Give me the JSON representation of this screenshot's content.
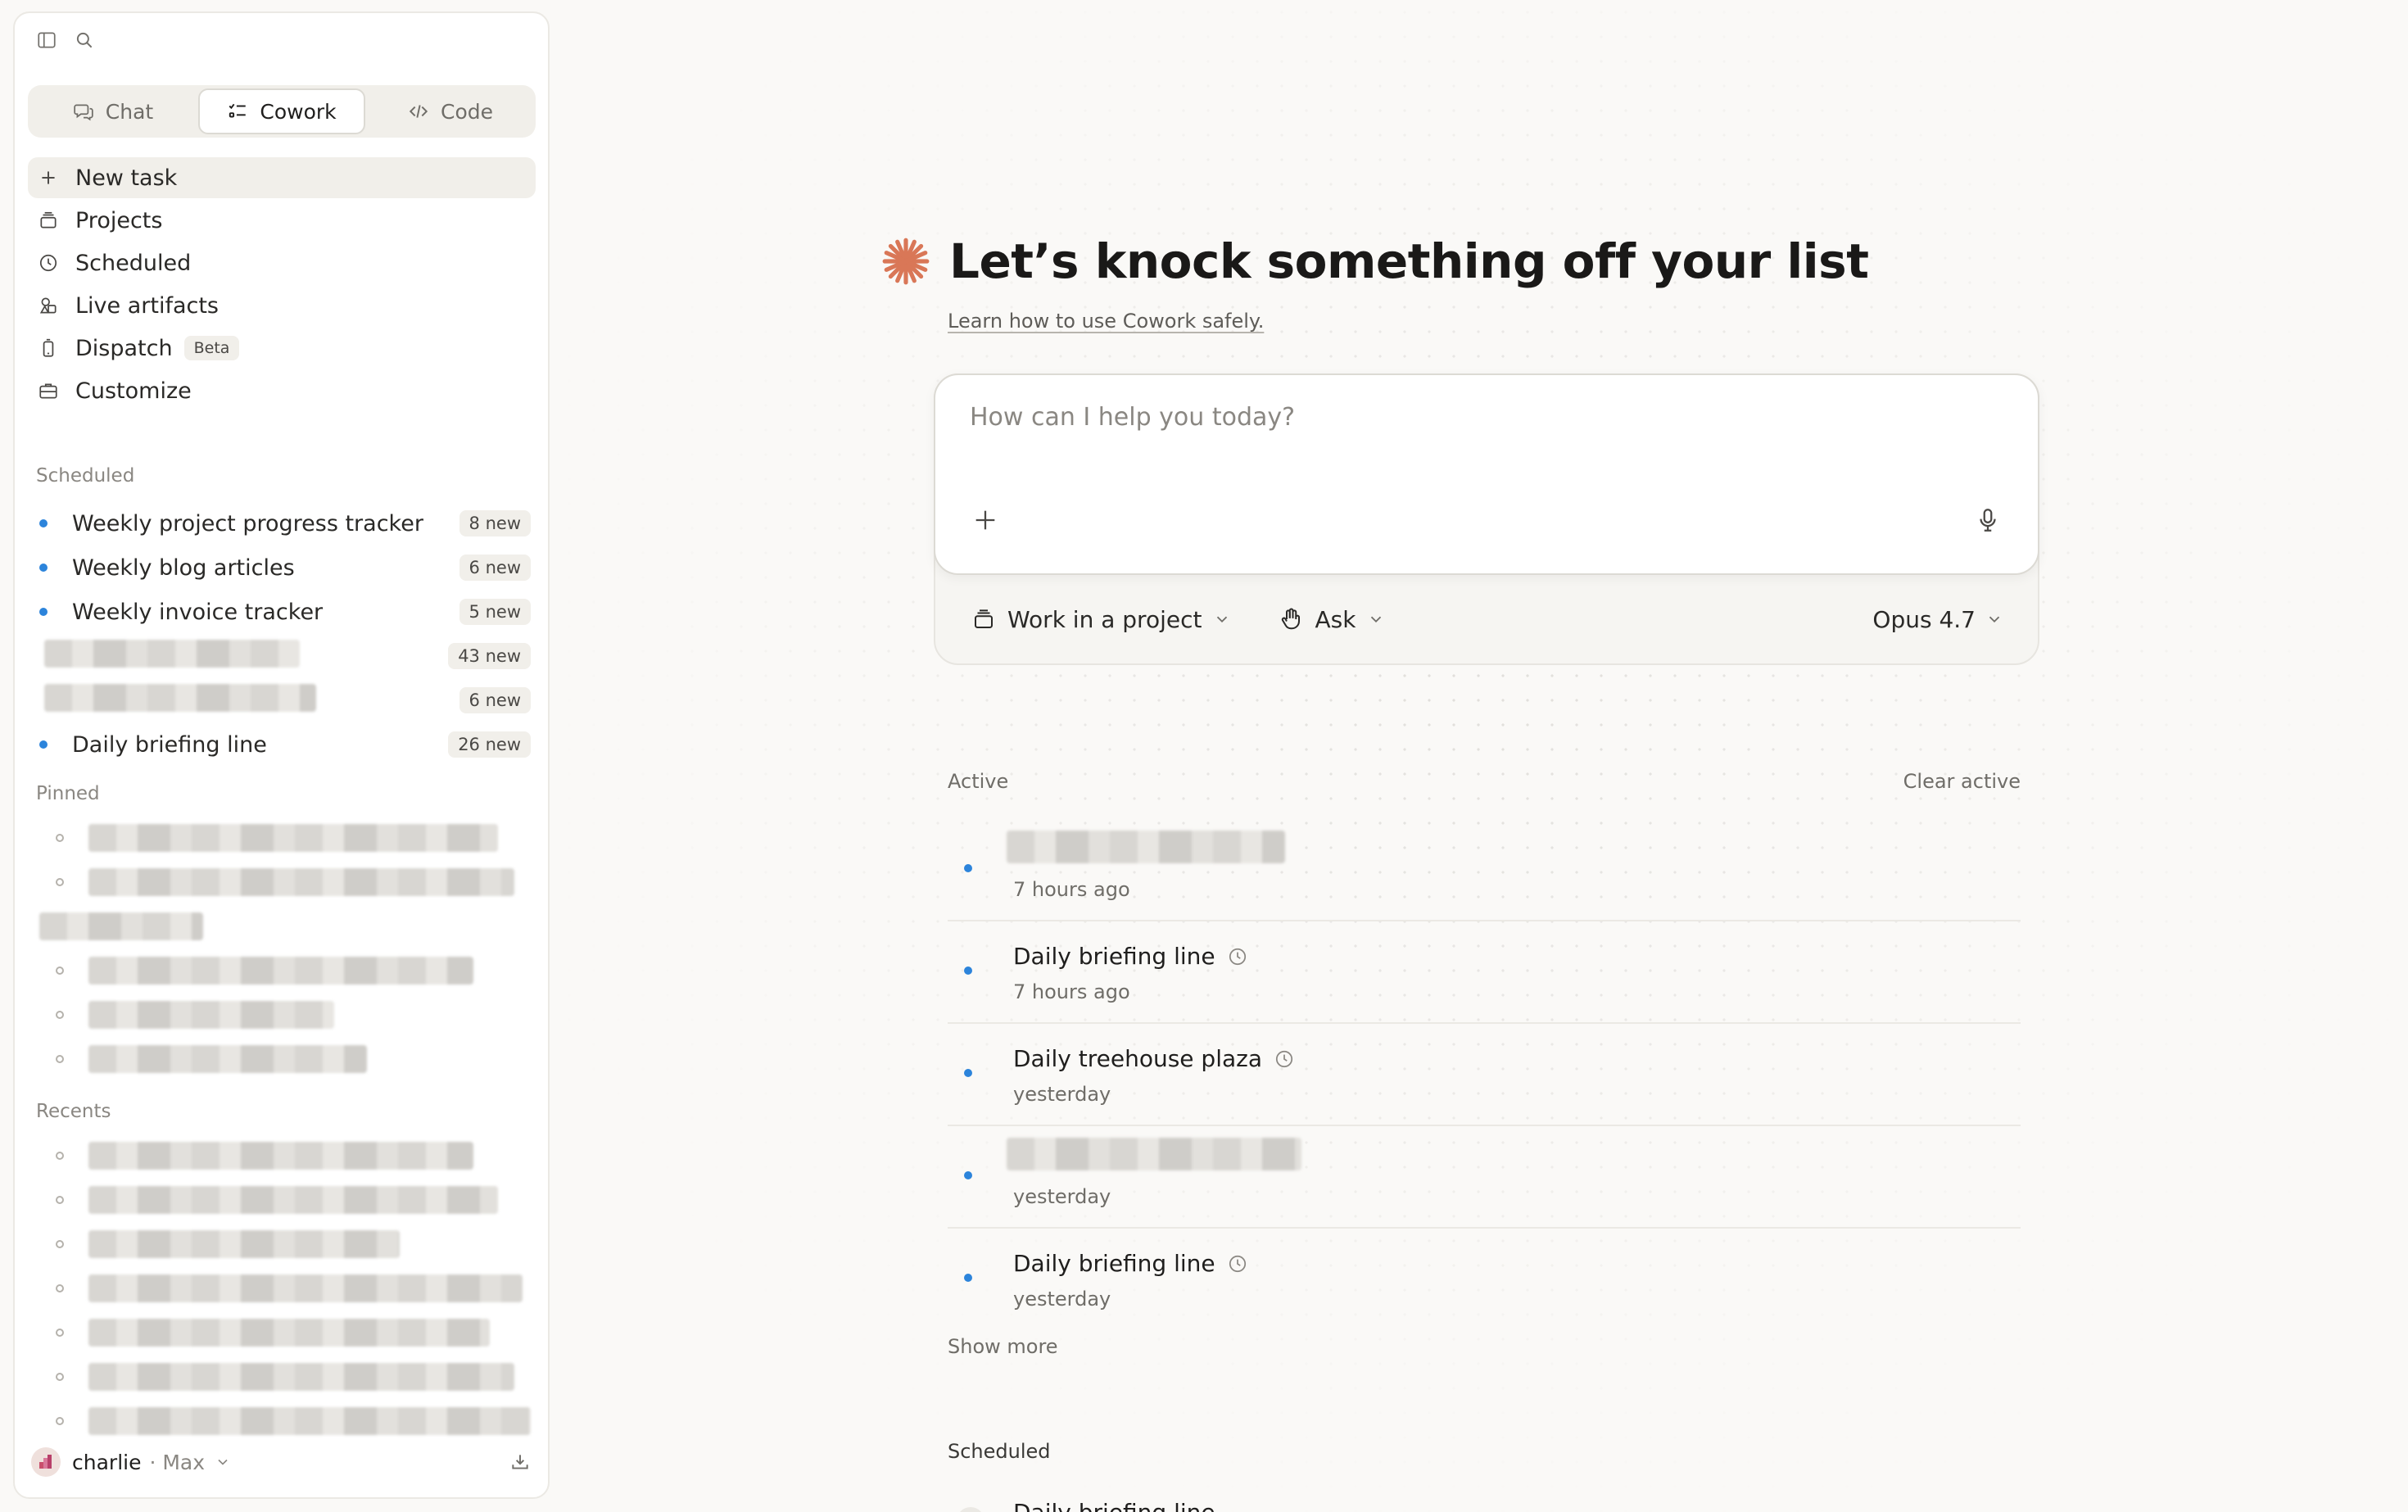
{
  "sidebar": {
    "modes": [
      {
        "label": "Chat",
        "icon": "chat-bubbles-icon",
        "active": false
      },
      {
        "label": "Cowork",
        "icon": "checklist-icon",
        "active": true
      },
      {
        "label": "Code",
        "icon": "code-brackets-icon",
        "active": false
      }
    ],
    "nav": {
      "new_task": "New task",
      "projects": "Projects",
      "scheduled": "Scheduled",
      "live_artifacts": "Live artifacts",
      "dispatch": "Dispatch",
      "dispatch_badge": "Beta",
      "customize": "Customize"
    },
    "scheduled_label": "Scheduled",
    "scheduled_items": [
      {
        "title": "Weekly project progress tracker",
        "badge": "8 new"
      },
      {
        "title": "Weekly blog articles",
        "badge": "6 new"
      },
      {
        "title": "Weekly invoice tracker",
        "badge": "5 new"
      },
      {
        "title": "",
        "badge": "43 new"
      },
      {
        "title": "",
        "badge": "6 new"
      },
      {
        "title": "Daily briefing line",
        "badge": "26 new"
      }
    ],
    "pinned_label": "Pinned",
    "recents_label": "Recents",
    "user": {
      "name": "charlie",
      "plan": "· Max"
    }
  },
  "main": {
    "hero_title": "Let’s knock something off your list",
    "learn_link": "Learn how to use Cowork safely.",
    "composer": {
      "placeholder": "How can I help you today?",
      "project_button": "Work in a project",
      "mode_button": "Ask",
      "model": "Opus 4.7"
    },
    "active_label": "Active",
    "clear_active": "Clear active",
    "active_tasks": [
      {
        "title": "",
        "time": "7 hours ago",
        "scheduled": false
      },
      {
        "title": "Daily briefing line",
        "time": "7 hours ago",
        "scheduled": true
      },
      {
        "title": "Daily treehouse plaza",
        "time": "yesterday",
        "scheduled": true
      },
      {
        "title": "",
        "time": "yesterday",
        "scheduled": false
      },
      {
        "title": "Daily briefing line",
        "time": "yesterday",
        "scheduled": true
      }
    ],
    "show_more": "Show more",
    "scheduled_label": "Scheduled",
    "scheduled_peek": "Daily briefing line"
  },
  "colors": {
    "accent": "#d97757",
    "unread_dot": "#2c84db",
    "background": "#faf9f7"
  }
}
